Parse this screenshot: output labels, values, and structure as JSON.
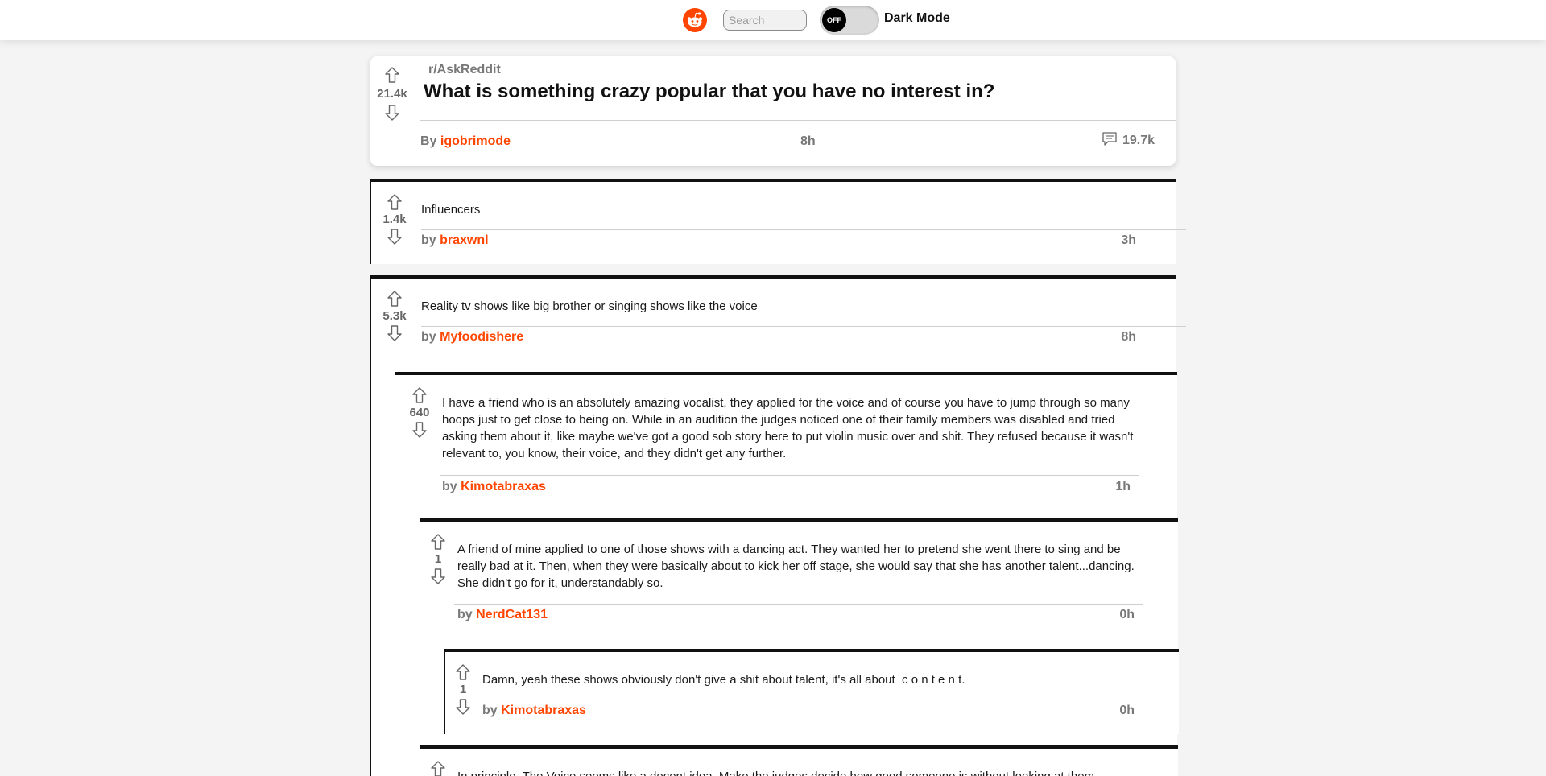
{
  "header": {
    "logo_icon": "reddit-alien-icon",
    "search_placeholder": "Search",
    "toggle_state": "OFF",
    "toggle_label": "Dark Mode",
    "brand_color": "#ff4500"
  },
  "post": {
    "subreddit": "r/AskReddit",
    "score": "21.4k",
    "title": "What is something crazy popular that you have no interest in?",
    "by_prefix": "By",
    "author": "igobrimode",
    "age": "8h",
    "comment_count": "19.7k"
  },
  "comments": [
    {
      "score": "1.4k",
      "text": "Influencers",
      "by_prefix": "by",
      "author": "braxwnl",
      "age": "3h"
    },
    {
      "score": "5.3k",
      "text": "Reality tv shows like big brother or singing shows like the voice",
      "by_prefix": "by",
      "author": "Myfoodishere",
      "age": "8h"
    },
    {
      "score": "640",
      "text": "I have a friend who is an absolutely amazing vocalist, they applied for the voice and of course you have to jump through so many hoops just to get close to being on. While in an audition the judges noticed one of their family members was disabled and tried asking them about it, like maybe we've got a good sob story here to put violin music over and shit. They refused because it wasn't relevant to, you know, their voice, and they didn't get any further.",
      "by_prefix": "by",
      "author": "Kimotabraxas",
      "age": "1h"
    },
    {
      "score": "1",
      "text": "A friend of mine applied to one of those shows with a dancing act. They wanted her to pretend she went there to sing and be really bad at it. Then, when they were basically about to kick her off stage, she would say that she has another talent...dancing. She didn't go for it, understandably so.",
      "by_prefix": "by",
      "author": "NerdCat131",
      "age": "0h"
    },
    {
      "score": "1",
      "text": "Damn, yeah these shows obviously don't give a shit about talent, it's all about  c o n t e n t.",
      "by_prefix": "by",
      "author": "Kimotabraxas",
      "age": "0h"
    },
    {
      "score": "",
      "text": "In principle, The Voice seems like a decent idea. Make the judges decide how good someone is without looking at them",
      "by_prefix": "",
      "author": "",
      "age": ""
    }
  ]
}
